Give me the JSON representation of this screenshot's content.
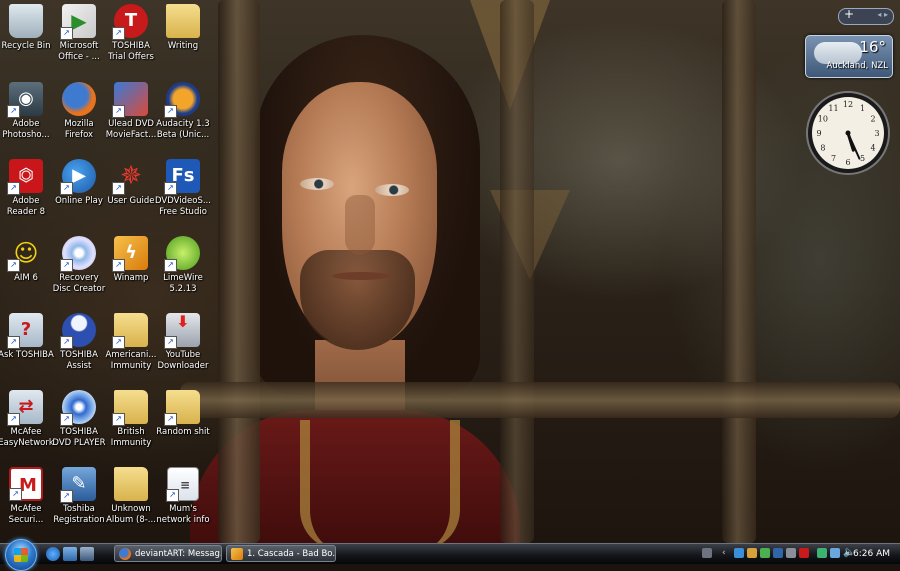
{
  "desktop": {
    "icons": [
      {
        "label": "Recycle Bin",
        "icon": "recycle-bin-icon"
      },
      {
        "label": "Microsoft\nOffice - ...",
        "icon": "office-icon"
      },
      {
        "label": "TOSHIBA\nTrial Offers",
        "icon": "toshiba-icon",
        "glyph": "T"
      },
      {
        "label": "Writing",
        "icon": "folder-icon"
      },
      {
        "label": "Adobe\nPhotosho...",
        "icon": "camera-icon"
      },
      {
        "label": "Mozilla\nFirefox",
        "icon": "firefox-icon"
      },
      {
        "label": "Ulead DVD\nMovieFact...",
        "icon": "ulead-icon"
      },
      {
        "label": "Audacity 1.3\nBeta (Unic...",
        "icon": "audacity-icon"
      },
      {
        "label": "Adobe\nReader 8",
        "icon": "adobe-reader-icon"
      },
      {
        "label": "Online Play",
        "icon": "play-icon"
      },
      {
        "label": "User Guide",
        "icon": "compass-icon"
      },
      {
        "label": "DVDVideoS...\nFree Studio",
        "icon": "free-studio-icon",
        "glyph": "Fs"
      },
      {
        "label": "AIM 6",
        "icon": "aim-icon"
      },
      {
        "label": "Recovery\nDisc Creator",
        "icon": "disc-icon"
      },
      {
        "label": "Winamp",
        "icon": "winamp-icon"
      },
      {
        "label": "LimeWire\n5.2.13",
        "icon": "limewire-icon"
      },
      {
        "label": "Ask TOSHIBA",
        "icon": "ask-icon"
      },
      {
        "label": "TOSHIBA\nAssist",
        "icon": "assist-icon"
      },
      {
        "label": "Americani...\nImmunity",
        "icon": "folder-icon"
      },
      {
        "label": "YouTube\nDownloader",
        "icon": "download-icon"
      },
      {
        "label": "McAfee\nEasyNetwork",
        "icon": "mcafee-network-icon"
      },
      {
        "label": "TOSHIBA\nDVD PLAYER",
        "icon": "dvd-icon"
      },
      {
        "label": "British\nImmunity",
        "icon": "folder-icon"
      },
      {
        "label": "Random shit",
        "icon": "folder-icon"
      },
      {
        "label": "McAfee\nSecuri...",
        "icon": "mcafee-icon",
        "glyph": "M"
      },
      {
        "label": "Toshiba\nRegistration",
        "icon": "registration-icon"
      },
      {
        "label": "Unknown\nAlbum (8-...",
        "icon": "folder-icon"
      },
      {
        "label": "Mum's\nnetwork info",
        "icon": "document-icon"
      }
    ]
  },
  "gadgets": {
    "weather": {
      "temperature": "16°",
      "location": "Auckland, NZL"
    },
    "clock": {
      "hour": 5,
      "minute": 26
    }
  },
  "taskbar": {
    "tasks": [
      {
        "label": "deviantART: Messag..."
      },
      {
        "label": "1. Cascada - Bad Bo..."
      }
    ],
    "time": "6:26 AM"
  }
}
